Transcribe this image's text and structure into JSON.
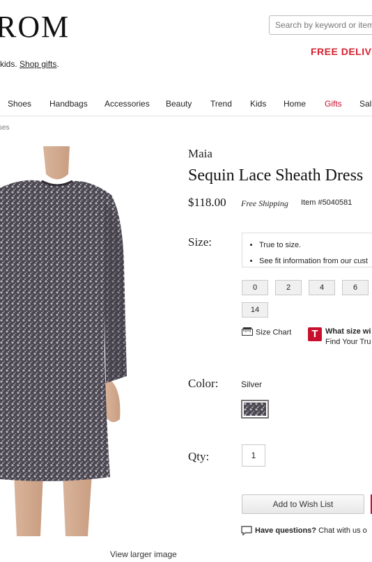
{
  "header": {
    "logo_text": "ROM",
    "search_placeholder": "Search by keyword or item",
    "free_delivery": "FREE DELIVE",
    "promo_prefix": "kids. ",
    "promo_link": "Shop gifts",
    "promo_suffix": "."
  },
  "nav": {
    "items": [
      {
        "label": "Shoes"
      },
      {
        "label": "Handbags"
      },
      {
        "label": "Accessories"
      },
      {
        "label": "Beauty"
      },
      {
        "label": "Trend"
      },
      {
        "label": "Kids"
      },
      {
        "label": "Home"
      },
      {
        "label": "Gifts",
        "active": true
      },
      {
        "label": "Sal"
      }
    ]
  },
  "breadcrumb": "ses",
  "product": {
    "brand": "Maia",
    "title": "Sequin Lace Sheath Dress",
    "price": "$118.00",
    "shipping": "Free Shipping",
    "item_number": "Item #5040581",
    "view_larger": "View larger image"
  },
  "size": {
    "label": "Size:",
    "tips": [
      "True to size.",
      "See fit information from our cust"
    ],
    "options": [
      "0",
      "2",
      "4",
      "6",
      "14"
    ],
    "size_chart": "Size Chart",
    "truefit_question": "What size wi",
    "truefit_sub": "Find Your Tru"
  },
  "color": {
    "label": "Color:",
    "value": "Silver"
  },
  "qty": {
    "label": "Qty:",
    "value": "1"
  },
  "actions": {
    "wish_list": "Add to Wish List",
    "questions_bold": "Have questions?",
    "questions_rest": " Chat with us o"
  },
  "colors": {
    "accent_red": "#c8102e",
    "button_gray": "#f0f0f0"
  }
}
